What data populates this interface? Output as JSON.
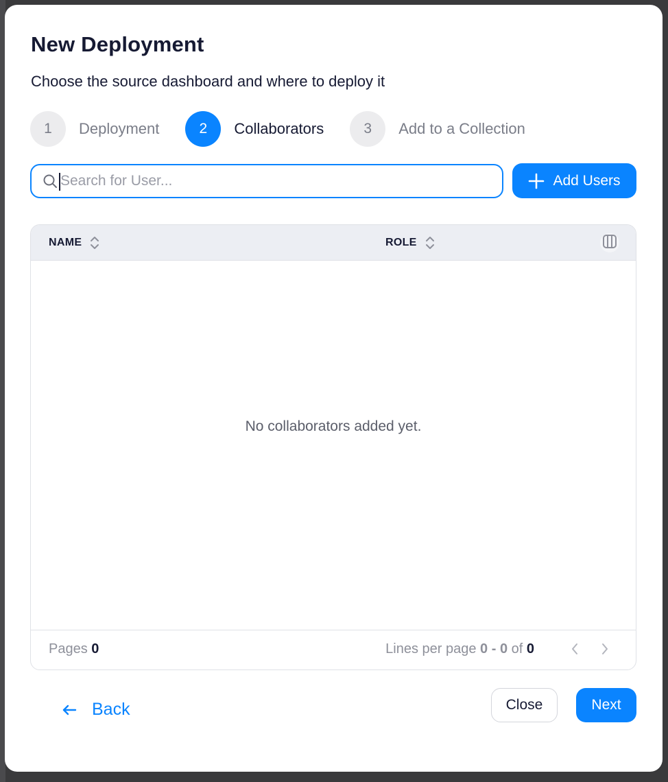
{
  "modal": {
    "title": "New Deployment",
    "subtitle": "Choose the source dashboard and where to deploy it"
  },
  "stepper": {
    "steps": [
      {
        "number": "1",
        "label": "Deployment",
        "state": "inactive"
      },
      {
        "number": "2",
        "label": "Collaborators",
        "state": "active"
      },
      {
        "number": "3",
        "label": "Add to a Collection",
        "state": "inactive"
      }
    ]
  },
  "search": {
    "placeholder": "Search for User...",
    "value": "",
    "icon": "search-icon"
  },
  "add_users": {
    "label": "Add Users",
    "icon": "plus-icon"
  },
  "table": {
    "columns": [
      {
        "label": "NAME",
        "icon": "sort-icon"
      },
      {
        "label": "ROLE",
        "icon": "sort-icon"
      }
    ],
    "columns_toggle_icon": "columns-icon",
    "rows": [],
    "empty_message": "No collaborators added yet.",
    "footer": {
      "pages_label": "Pages",
      "pages_value": "0",
      "lines_label": "Lines per page",
      "range_start": "0",
      "range_sep": "-",
      "range_end": "0",
      "of_label": "of",
      "total": "0"
    }
  },
  "actions": {
    "back_label": "Back",
    "close_label": "Close",
    "next_label": "Next"
  },
  "colors": {
    "accent": "#0a84ff",
    "text": "#161a33",
    "muted": "#7a7d88"
  }
}
